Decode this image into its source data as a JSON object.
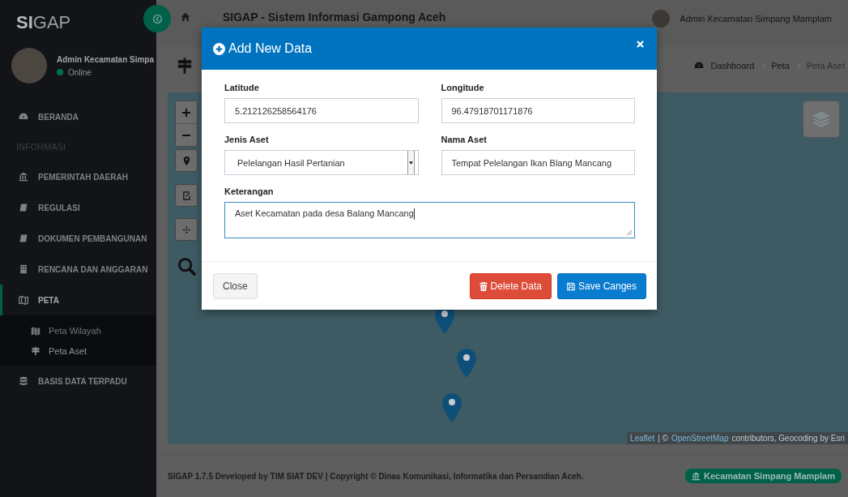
{
  "app": {
    "logo_bold": "SI",
    "logo_rest": "GAP"
  },
  "sidebar": {
    "user": {
      "name": "Admin Kecamatan Simpa",
      "status": "Online",
      "online": true
    },
    "items": [
      {
        "kind": "item",
        "label": "BERANDA",
        "selected": false
      },
      {
        "kind": "header",
        "label": "INFORMASI"
      },
      {
        "kind": "item",
        "label": "PEMERINTAH DAERAH",
        "selected": false
      },
      {
        "kind": "item",
        "label": "REGULASI",
        "selected": false
      },
      {
        "kind": "item",
        "label": "DOKUMEN PEMBANGUNAN",
        "selected": false
      },
      {
        "kind": "item",
        "label": "RENCANA DAN ANGGARAN",
        "selected": false
      },
      {
        "kind": "item",
        "label": "PETA",
        "selected": true,
        "children": [
          {
            "label": "Peta Wilayah",
            "selected": false
          },
          {
            "label": "Peta Aset",
            "selected": true
          }
        ]
      },
      {
        "kind": "item",
        "label": "BASIS DATA TERPADU",
        "selected": false
      }
    ]
  },
  "topbar": {
    "title": "SIGAP - Sistem Informasi Gampong Aceh",
    "user": "Admin Kecamatan Simpang Mamplam"
  },
  "breadcrumb": [
    "Dashboard",
    "Peta",
    "Peta Aset"
  ],
  "map": {
    "attribution": [
      {
        "kind": "link",
        "text": "Leaflet"
      },
      {
        "kind": "text",
        "text": "| ©"
      },
      {
        "kind": "link",
        "text": "OpenStreetMap"
      },
      {
        "kind": "text",
        "text": "contributors, Geocoding by Esri"
      }
    ]
  },
  "modal": {
    "title": "Add New Data",
    "fields": [
      {
        "kind": "input",
        "label": "Latitude",
        "value": "5.212126258564176",
        "focused": false
      },
      {
        "kind": "input",
        "label": "Longitude",
        "value": "96.47918701171876",
        "focused": false
      },
      {
        "kind": "select",
        "label": "Jenis Aset",
        "value": "Pelelangan Hasil Pertanian",
        "focused": false
      },
      {
        "kind": "input",
        "label": "Nama Aset",
        "value": "Tempat Pelelangan Ikan Blang Mancang",
        "focused": false
      },
      {
        "kind": "textarea",
        "label": "Keterangan",
        "value": "Aset Kecamatan pada desa Balang Mancang",
        "focused": true
      }
    ],
    "buttons": [
      {
        "kind": "default",
        "label": "Close"
      },
      {
        "kind": "danger",
        "label": "Delete Data"
      },
      {
        "kind": "primary",
        "label": "Save Canges"
      }
    ]
  },
  "footer": {
    "text": "SIGAP 1.7.5 Developed by TIM SIAT DEV | Copyright © Dinas Komunikasi, Informatika dan Persandian Aceh.",
    "badge": "Kecamatan Simpang Mamplam"
  }
}
